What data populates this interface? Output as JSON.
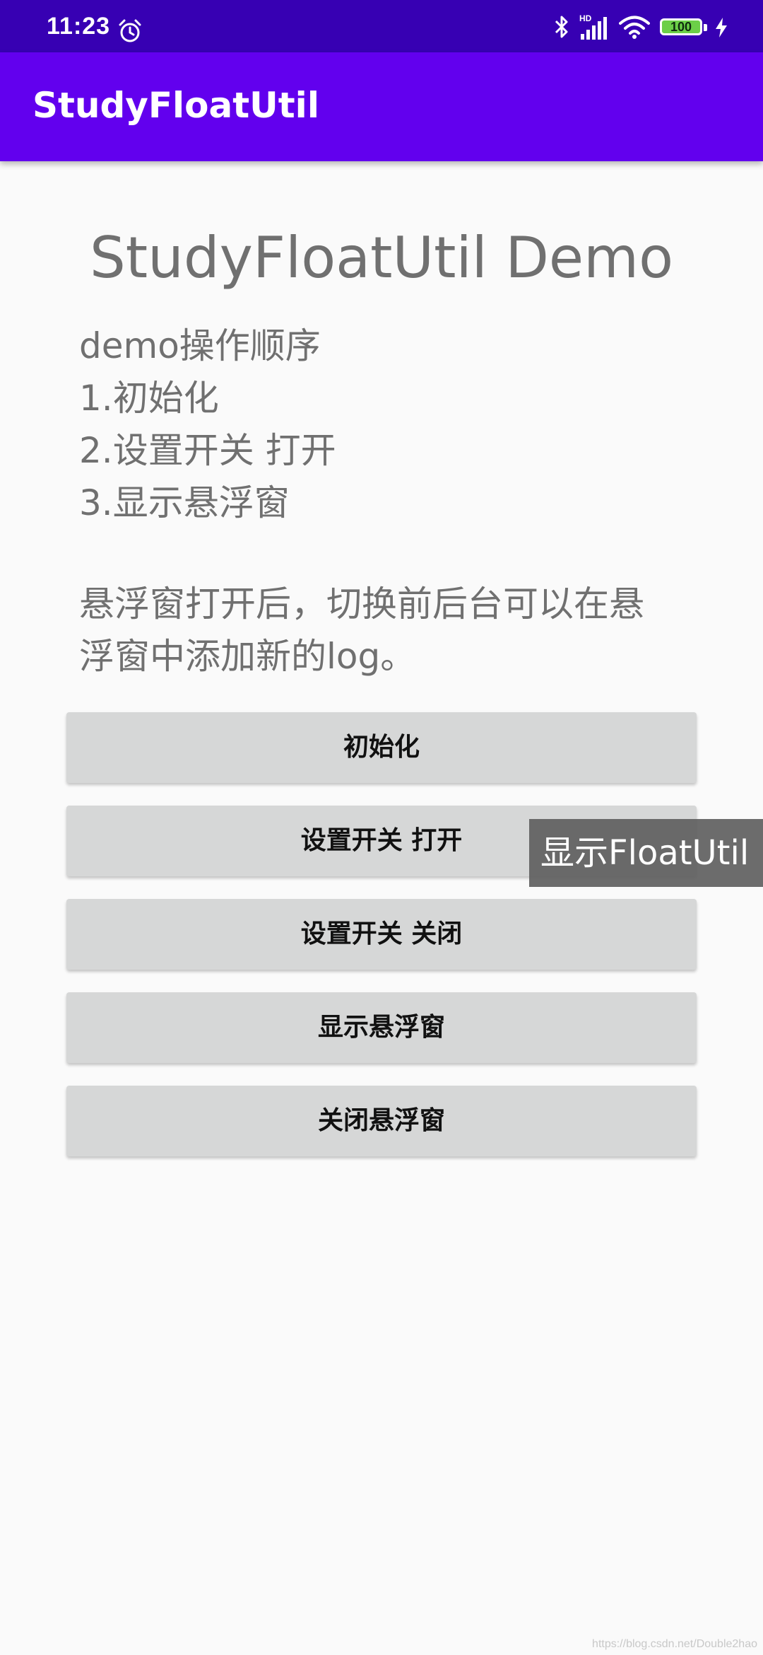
{
  "status_bar": {
    "time": "11:23",
    "battery": "100",
    "icons": [
      "alarm-icon",
      "bluetooth-icon",
      "signal-icon",
      "wifi-icon",
      "battery-icon",
      "charging-icon"
    ]
  },
  "app_bar": {
    "title": "StudyFloatUtil"
  },
  "main": {
    "heading": "StudyFloatUtil Demo",
    "instructions": [
      "demo操作顺序",
      "1.初始化",
      "2.设置开关 打开",
      "3.显示悬浮窗"
    ],
    "note": "悬浮窗打开后，切换前后台可以在悬浮窗中添加新的log。",
    "buttons": [
      "初始化",
      "设置开关 打开",
      "设置开关 关闭",
      "显示悬浮窗",
      "关闭悬浮窗"
    ]
  },
  "floating_window": {
    "label": "显示FloatUtil"
  },
  "watermark": "https://blog.csdn.net/Double2hao",
  "colors": {
    "status_bar": "#3700b3",
    "app_bar": "#6200ee",
    "background": "#fafafa",
    "button": "#d6d7d7",
    "text_secondary": "#707070",
    "floating_window": "#5f5f5f"
  }
}
